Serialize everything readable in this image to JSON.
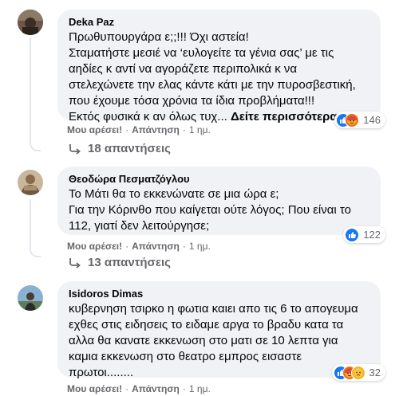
{
  "comments": [
    {
      "author": "Deka Paz",
      "lines": [
        "Πρωθυπουργάρα ε;;!!! Όχι αστεία!",
        "Σταματήστε μεσιέ να ‘ευλογείτε τα γένια σας’ με τις",
        "αηδίες κ αντί να αγοράζετε περιπολικά κ να",
        "στελεχώνετε την ελας κάντε κάτι με την πυροσβεστική,",
        "που έχουμε τόσα χρόνια τα ίδια προβλήματα!!!",
        "Εκτός φυσικά κ αν όλως τυχ..."
      ],
      "see_more": "Δείτε περισσότερα",
      "reaction_count": "146",
      "like_label": "Μου αρέσει!",
      "reply_label": "Απάντηση",
      "time": "1 ημ.",
      "replies_label": "18 απαντήσεις"
    },
    {
      "author": "Θεοδώρα Πεσματζόγλου",
      "lines": [
        "Το Μάτι θα το εκκενώνατε σε μια ώρα ε;",
        "Για την Κόρινθο που καίγεται ούτε λόγος; Που είναι το",
        "112, γιατί δεν λειτούργησε;"
      ],
      "reaction_count": "122",
      "like_label": "Μου αρέσει!",
      "reply_label": "Απάντηση",
      "time": "1 ημ.",
      "replies_label": "13 απαντήσεις"
    },
    {
      "author": "Isidoros Dimas",
      "lines": [
        "κυβερνηση τσιρκο η φωτια καιει απο τις 6 το απογευμα",
        "εχθες στις ειδησεις το ειδαμε αργα το βραδυ κατα τα",
        "αλλα θα κανατε εκκενωση στο ματι σε 10 λεπτα για",
        "καμια εκκενωση στο θεατρο εμπρος εισαστε",
        "πρωτοι........"
      ],
      "reaction_count": "32",
      "like_label": "Μου αρέσει!",
      "reply_label": "Απάντηση",
      "time": "1 ημ."
    }
  ],
  "colors": {
    "bubble": "#f0f2f5",
    "secondary_text": "#65676b",
    "like_blue": "#1877f2",
    "angry_orange": "#f7b125"
  }
}
